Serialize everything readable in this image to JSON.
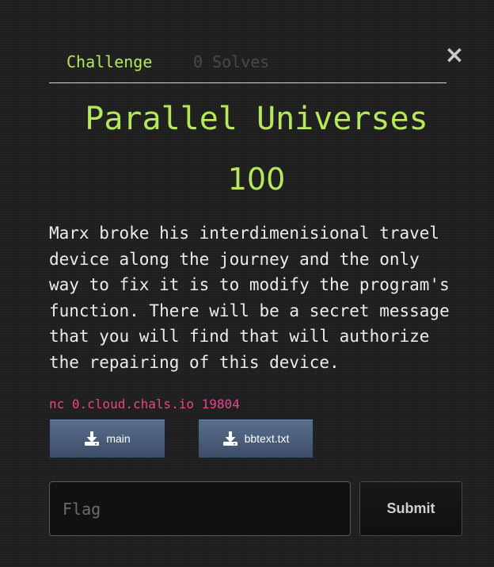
{
  "tabs": [
    {
      "label": "Challenge",
      "active": true
    },
    {
      "label": "0 Solves",
      "active": false
    }
  ],
  "close_label": "×",
  "challenge": {
    "title": "Parallel Universes",
    "points": "100",
    "description": "Marx broke his interdimenisional travel\ndevice along the journey and the only\nway to fix it is to modify the program's\nfunction. There will be a secret message\nthat you will find that will authorize\nthe repairing of this device.",
    "connection": "nc 0.cloud.chals.io 19804",
    "files": [
      {
        "label": "main",
        "icon": "download-icon"
      },
      {
        "label": "bbtext.txt",
        "icon": "download-icon"
      }
    ]
  },
  "form": {
    "flag_placeholder": "Flag",
    "flag_value": "",
    "submit_label": "Submit"
  },
  "colors": {
    "accent": "#b5e85a",
    "link": "#e8458b",
    "background": "#1d1d1d"
  }
}
